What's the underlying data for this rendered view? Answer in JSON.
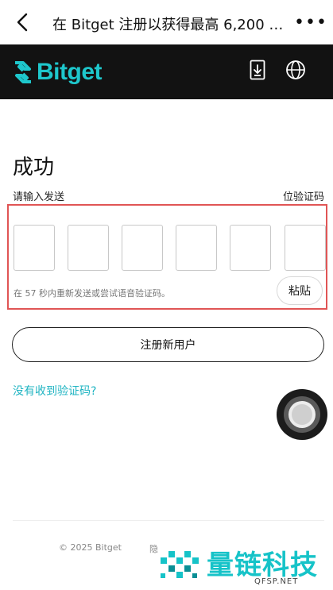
{
  "nav": {
    "back_icon": "chevron-left-icon",
    "title": "在 Bitget 注册以获得最高 6,200 U...",
    "more_label": "•••"
  },
  "brand": {
    "logo_text": "Bitget",
    "logo_color": "#1ec7cc",
    "header_bg": "#121212"
  },
  "content": {
    "heading": "成功",
    "subtext_left": "请输入发送",
    "subtext_right": "位验证码",
    "code_cells": [
      "",
      "",
      "",
      "",
      "",
      ""
    ],
    "resend_text": "在 57 秒内重新发送或尝试语音验证码。",
    "paste_label": "粘贴",
    "register_label": "注册新用户",
    "no_code_link": "没有收到验证码?"
  },
  "footer": {
    "copyright": "© 2025 Bitget",
    "privacy_fragment": "隐"
  },
  "watermark": {
    "text": "量链科技",
    "sub": "QFSP.NET",
    "color": "#16c3c8"
  },
  "colors": {
    "accent": "#1fb4c2",
    "highlight_border": "#e05555"
  }
}
